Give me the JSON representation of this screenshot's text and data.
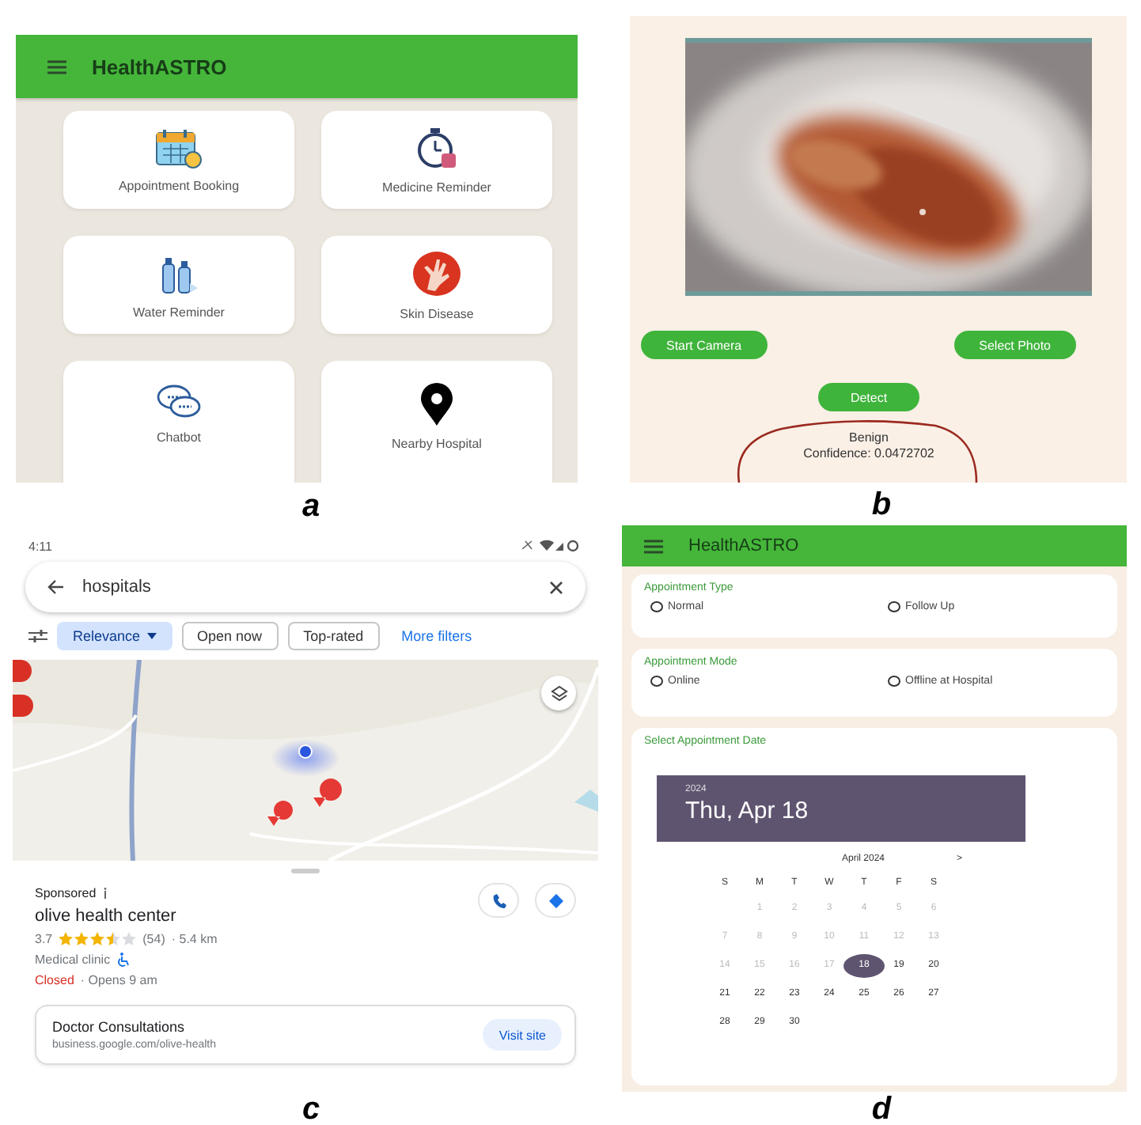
{
  "panel_a": {
    "label": "a",
    "app_bar": {
      "title": "HealthASTRO"
    },
    "tiles": [
      {
        "label": "Appointment Booking",
        "kind": "calendar"
      },
      {
        "label": "Medicine Reminder",
        "kind": "stopwatch"
      },
      {
        "label": "Water Reminder",
        "kind": "bottles"
      },
      {
        "label": "Skin Disease",
        "kind": "hand"
      },
      {
        "label": "Chatbot",
        "kind": "chat"
      },
      {
        "label": "Nearby Hospital",
        "kind": "pin"
      }
    ]
  },
  "panel_b": {
    "label": "b",
    "photo": {
      "kind": "picture"
    },
    "buttons": [
      "Start Camera",
      "Select Photo"
    ],
    "detect_button": "Detect",
    "result": {
      "class": "Benign",
      "confidence": "Confidence: 0.0472702"
    }
  },
  "panel_c": {
    "label": "c",
    "status_bar": {
      "time": "4:11"
    },
    "search": {
      "value": "hospitals"
    },
    "filters": [
      {
        "label": "Relevance",
        "selected": true
      },
      {
        "label": "Open now",
        "selected": false
      },
      {
        "label": "Top-rated",
        "selected": false
      }
    ],
    "more_filters": "More filters",
    "map": {
      "kind": "picture"
    },
    "result": {
      "sponsored": "Sponsored",
      "name": "olive health center",
      "rating": "3.7",
      "stars": 3.5,
      "reviews": "(54)",
      "distance": "· 5.4 km",
      "category": "Medical clinic",
      "status": "Closed",
      "hours": "· Opens 9 am"
    },
    "ad": {
      "title": "Doctor Consultations",
      "url": "business.google.com/olive-health",
      "button": "Visit site"
    }
  },
  "panel_d": {
    "label": "d",
    "app_bar": {
      "title": "HealthASTRO"
    },
    "groups": [
      {
        "title": "Appointment Type",
        "options": [
          {
            "label": "Normal",
            "selected": false
          },
          {
            "label": "Follow Up",
            "selected": false
          }
        ]
      },
      {
        "title": "Appointment Mode",
        "options": [
          {
            "label": "Online",
            "selected": false
          },
          {
            "label": "Offline at Hospital",
            "selected": false
          }
        ]
      }
    ],
    "date_card": {
      "title": "Select Appointment Date",
      "year": "2024",
      "date": "Thu, Apr 18",
      "month": "April 2024",
      "next": ">",
      "weekdays": [
        "S",
        "M",
        "T",
        "W",
        "T",
        "F",
        "S"
      ],
      "weeks": [
        [
          {
            "day": "1",
            "selected": false,
            "disabled": true
          },
          {
            "day": "2",
            "selected": false,
            "disabled": true
          },
          {
            "day": "3",
            "selected": false,
            "disabled": true
          },
          {
            "day": "4",
            "selected": false,
            "disabled": true
          },
          {
            "day": "5",
            "selected": false,
            "disabled": true
          },
          {
            "day": "6",
            "selected": false,
            "disabled": true
          }
        ],
        [
          {
            "day": "7",
            "selected": false,
            "disabled": true
          },
          {
            "day": "8",
            "selected": false,
            "disabled": true
          },
          {
            "day": "9",
            "selected": false,
            "disabled": true
          },
          {
            "day": "10",
            "selected": false,
            "disabled": true
          },
          {
            "day": "11",
            "selected": false,
            "disabled": true
          },
          {
            "day": "12",
            "selected": false,
            "disabled": true
          },
          {
            "day": "13",
            "selected": false,
            "disabled": true
          }
        ],
        [
          {
            "day": "14",
            "selected": false,
            "disabled": true
          },
          {
            "day": "15",
            "selected": false,
            "disabled": true
          },
          {
            "day": "16",
            "selected": false,
            "disabled": true
          },
          {
            "day": "17",
            "selected": false,
            "disabled": true
          },
          {
            "day": "18",
            "selected": true,
            "disabled": false
          },
          {
            "day": "19",
            "selected": false,
            "disabled": false
          },
          {
            "day": "20",
            "selected": false,
            "disabled": false
          }
        ],
        [
          {
            "day": "21",
            "selected": false,
            "disabled": false
          },
          {
            "day": "22",
            "selected": false,
            "disabled": false
          },
          {
            "day": "23",
            "selected": false,
            "disabled": false
          },
          {
            "day": "24",
            "selected": false,
            "disabled": false
          },
          {
            "day": "25",
            "selected": false,
            "disabled": false
          },
          {
            "day": "26",
            "selected": false,
            "disabled": false
          },
          {
            "day": "27",
            "selected": false,
            "disabled": false
          }
        ],
        [
          {
            "day": "28",
            "selected": false,
            "disabled": false
          },
          {
            "day": "29",
            "selected": false,
            "disabled": false
          },
          {
            "day": "30",
            "selected": false,
            "disabled": false
          }
        ]
      ]
    }
  }
}
